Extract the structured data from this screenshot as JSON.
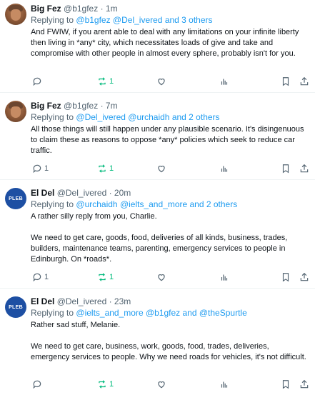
{
  "tweets": [
    {
      "name": "Big Fez",
      "handle": "@b1gfez",
      "time": "1m",
      "replying_prefix": "Replying to",
      "mentions": "@b1gfez @Del_ivered and 3 others",
      "body": [
        "And FWIW, if you arent able to deal with any limitations on your infinite liberty then living in *any* city, which necessitates loads of give and take and compromise with other people in almost every sphere, probably isn't for you."
      ],
      "reply_count": "",
      "retweet_count": "1",
      "avatar_icon": "profile-photo"
    },
    {
      "name": "Big Fez",
      "handle": "@b1gfez",
      "time": "7m",
      "replying_prefix": "Replying to",
      "mentions": "@Del_ivered @urchaidh and 2 others",
      "body": [
        "All those things will still happen  under any plausible scenario. It's disingenuous to claim these as reasons to oppose *any* policies which seek to reduce car traffic."
      ],
      "reply_count": "1",
      "retweet_count": "1",
      "avatar_icon": "profile-photo"
    },
    {
      "name": "El Del",
      "handle": "@Del_ivered",
      "time": "20m",
      "replying_prefix": "Replying to",
      "mentions": "@urchaidh @ielts_and_more and 2 others",
      "body": [
        "A rather silly reply from you, Charlie.",
        "We need to get care, goods, food, deliveries of all kinds, business, trades, builders, maintenance teams, parenting, emergency services to people in Edinburgh. On *roads*."
      ],
      "reply_count": "1",
      "retweet_count": "1",
      "avatar_text": "PLEB"
    },
    {
      "name": "El Del",
      "handle": "@Del_ivered",
      "time": "23m",
      "replying_prefix": "Replying to",
      "mentions": "@ielts_and_more @b1gfez and @theSpurtle",
      "body": [
        "Rather sad stuff, Melanie.",
        "We need to get care, business, work, goods, food, trades, deliveries, emergency services to people. Why we need roads for vehicles, it's not difficult."
      ],
      "reply_count": "",
      "retweet_count": "1",
      "avatar_text": "PLEB"
    }
  ],
  "colors": {
    "mention": "#1d9bf0",
    "retweet": "#00ba7c",
    "muted": "#536471"
  }
}
